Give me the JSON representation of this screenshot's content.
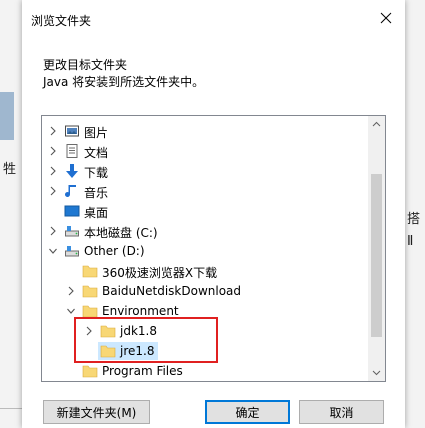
{
  "dialog": {
    "title": "浏览文件夹",
    "description_line1": "更改目标文件夹",
    "description_line2": "Java 将安装到所选文件夹中。"
  },
  "background": {
    "left_glyph": "牲",
    "right_glyph_1": "搭",
    "right_glyph_2": "Ⅱ"
  },
  "tree": {
    "items": [
      {
        "label": "图片",
        "icon": "pictures-icon",
        "expander": "collapsed"
      },
      {
        "label": "文档",
        "icon": "documents-icon",
        "expander": "collapsed"
      },
      {
        "label": "下载",
        "icon": "download-icon",
        "expander": "collapsed"
      },
      {
        "label": "音乐",
        "icon": "music-icon",
        "expander": "collapsed"
      },
      {
        "label": "桌面",
        "icon": "desktop-icon",
        "expander": "none"
      },
      {
        "label": "本地磁盘 (C:)",
        "icon": "drive-icon",
        "expander": "collapsed"
      },
      {
        "label": "Other (D:)",
        "icon": "drive-icon",
        "expander": "expanded"
      },
      {
        "label": "360极速浏览器X下载",
        "icon": "folder-icon",
        "expander": "none"
      },
      {
        "label": "BaiduNetdiskDownload",
        "icon": "folder-icon",
        "expander": "collapsed"
      },
      {
        "label": "Environment",
        "icon": "folder-icon",
        "expander": "expanded"
      },
      {
        "label": "jdk1.8",
        "icon": "folder-icon",
        "expander": "collapsed"
      },
      {
        "label": "jre1.8",
        "icon": "folder-icon",
        "expander": "none",
        "selected": true
      },
      {
        "label": "Program Files",
        "icon": "folder-icon",
        "expander": "none"
      }
    ]
  },
  "buttons": {
    "new_folder": "新建文件夹(M)",
    "ok": "确定",
    "cancel": "取消"
  },
  "colors": {
    "highlight_border": "#e02020",
    "selection_bg": "#cce8ff",
    "accent": "#0078d7",
    "folder": "#f8d775"
  }
}
